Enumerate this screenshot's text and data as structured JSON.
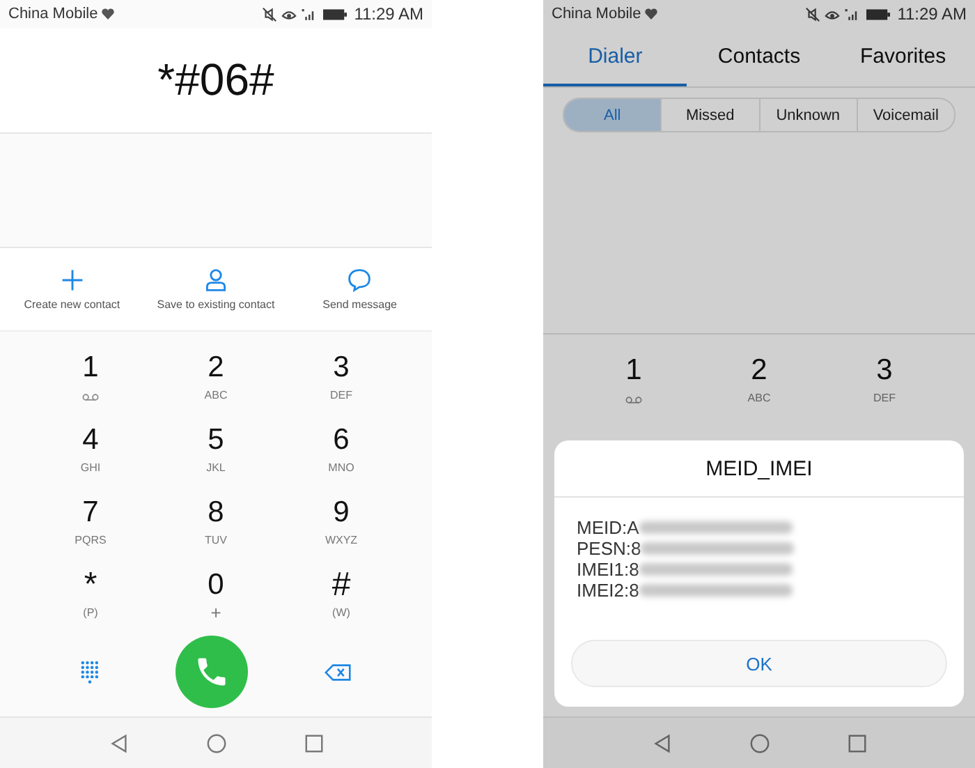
{
  "dialer_screen": {
    "status_bar": {
      "carrier": "China Mobile",
      "time": "11:29 AM"
    },
    "dialed_number": "*#06#",
    "actions": [
      {
        "kind": "add",
        "label": "Create new contact"
      },
      {
        "kind": "person",
        "label": "Save to existing contact"
      },
      {
        "kind": "message",
        "label": "Send message"
      }
    ],
    "keypad": [
      {
        "digit": "1",
        "kind": "voicemail"
      },
      {
        "digit": "2",
        "kind": "letters",
        "letters": "ABC"
      },
      {
        "digit": "3",
        "kind": "letters",
        "letters": "DEF"
      },
      {
        "digit": "4",
        "kind": "letters",
        "letters": "GHI"
      },
      {
        "digit": "5",
        "kind": "letters",
        "letters": "JKL"
      },
      {
        "digit": "6",
        "kind": "letters",
        "letters": "MNO"
      },
      {
        "digit": "7",
        "kind": "letters",
        "letters": "PQRS"
      },
      {
        "digit": "8",
        "kind": "letters",
        "letters": "TUV"
      },
      {
        "digit": "9",
        "kind": "letters",
        "letters": "WXYZ"
      },
      {
        "digit": "*",
        "kind": "symbol",
        "letters": "(P)"
      },
      {
        "digit": "0",
        "kind": "letters",
        "letters": "+"
      },
      {
        "digit": "#",
        "kind": "symbol",
        "letters": "(W)"
      }
    ]
  },
  "dialog_screen": {
    "status_bar": {
      "carrier": "China Mobile",
      "time": "11:29 AM"
    },
    "tabs": [
      {
        "label": "Dialer",
        "selected": true
      },
      {
        "label": "Contacts",
        "selected": false
      },
      {
        "label": "Favorites",
        "selected": false
      }
    ],
    "filters": [
      {
        "label": "All",
        "selected": true
      },
      {
        "label": "Missed",
        "selected": false
      },
      {
        "label": "Unknown",
        "selected": false
      },
      {
        "label": "Voicemail",
        "selected": false
      }
    ],
    "keypad": [
      {
        "digit": "1",
        "kind": "voicemail"
      },
      {
        "digit": "2",
        "kind": "letters",
        "letters": "ABC"
      },
      {
        "digit": "3",
        "kind": "letters",
        "letters": "DEF"
      }
    ],
    "dialog": {
      "title": "MEID_IMEI",
      "lines": [
        {
          "label": "MEID:A",
          "redacted": true
        },
        {
          "label": "PESN:8",
          "redacted": true
        },
        {
          "label": "IMEI1:8",
          "redacted": true
        },
        {
          "label": "IMEI2:8",
          "redacted": true
        }
      ],
      "button": "OK"
    }
  }
}
